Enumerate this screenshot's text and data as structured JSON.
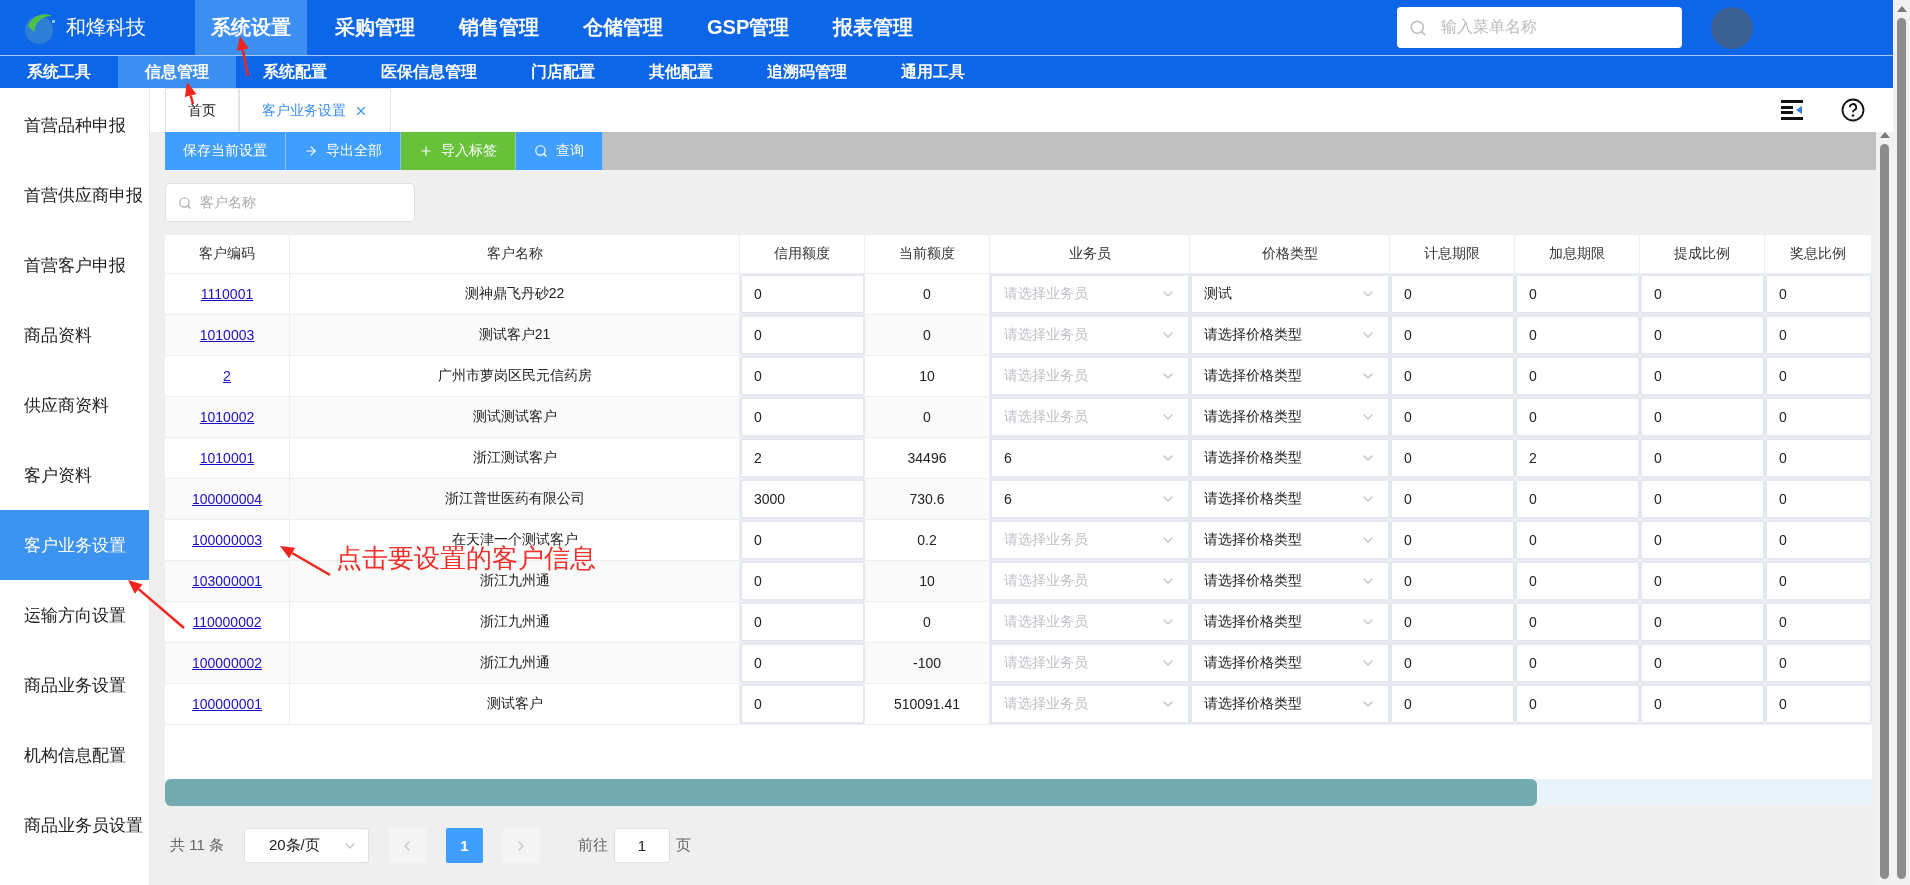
{
  "brand": {
    "name": "和烽科技"
  },
  "top_nav": [
    {
      "label": "系统设置",
      "selected": true
    },
    {
      "label": "采购管理",
      "selected": false
    },
    {
      "label": "销售管理",
      "selected": false
    },
    {
      "label": "仓储管理",
      "selected": false
    },
    {
      "label": "GSP管理",
      "selected": false
    },
    {
      "label": "报表管理",
      "selected": false
    }
  ],
  "menu_search": {
    "placeholder": "输入菜单名称"
  },
  "sub_nav": [
    {
      "label": "系统工具",
      "selected": false
    },
    {
      "label": "信息管理",
      "selected": true
    },
    {
      "label": "系统配置",
      "selected": false
    },
    {
      "label": "医保信息管理",
      "selected": false
    },
    {
      "label": "门店配置",
      "selected": false
    },
    {
      "label": "其他配置",
      "selected": false
    },
    {
      "label": "追溯码管理",
      "selected": false
    },
    {
      "label": "通用工具",
      "selected": false
    }
  ],
  "sidebar": {
    "items": [
      {
        "label": "首营品种申报",
        "selected": false
      },
      {
        "label": "首营供应商申报",
        "selected": false
      },
      {
        "label": "首营客户申报",
        "selected": false
      },
      {
        "label": "商品资料",
        "selected": false
      },
      {
        "label": "供应商资料",
        "selected": false
      },
      {
        "label": "客户资料",
        "selected": false
      },
      {
        "label": "客户业务设置",
        "selected": true
      },
      {
        "label": "运输方向设置",
        "selected": false
      },
      {
        "label": "商品业务设置",
        "selected": false
      },
      {
        "label": "机构信息配置",
        "selected": false
      },
      {
        "label": "商品业务员设置",
        "selected": false
      }
    ]
  },
  "page_tabs": [
    {
      "label": "首页",
      "selected": false,
      "closable": false
    },
    {
      "label": "客户业务设置",
      "selected": true,
      "closable": true
    }
  ],
  "toolbar": [
    {
      "label": "保存当前设置",
      "kind": "primary"
    },
    {
      "label": "导出全部",
      "kind": "primary"
    },
    {
      "label": "导入标签",
      "kind": "success"
    },
    {
      "label": "查询",
      "kind": "primary"
    }
  ],
  "filter": {
    "placeholder": "客户名称"
  },
  "table": {
    "columns": [
      "客户编码",
      "客户名称",
      "信用额度",
      "当前额度",
      "业务员",
      "价格类型",
      "计息期限",
      "加息期限",
      "提成比例",
      "奖息比例"
    ],
    "rows": [
      {
        "code": "1110001",
        "name": "测神鼎飞丹砂22",
        "credit": "0",
        "current": "0",
        "salesman": {
          "placeholder": "请选择业务员"
        },
        "price_type": "测试",
        "interest_term": "0",
        "add_term": "0",
        "commission": "0",
        "bonus": "0"
      },
      {
        "code": "1010003",
        "name": "测试客户21",
        "credit": "0",
        "current": "0",
        "salesman": {
          "placeholder": "请选择业务员"
        },
        "price_type": "请选择价格类型",
        "interest_term": "0",
        "add_term": "0",
        "commission": "0",
        "bonus": "0"
      },
      {
        "code": "2",
        "name": "广州市萝岗区民元信药房",
        "credit": "0",
        "current": "10",
        "salesman": {
          "placeholder": "请选择业务员"
        },
        "price_type": "请选择价格类型",
        "interest_term": "0",
        "add_term": "0",
        "commission": "0",
        "bonus": "0"
      },
      {
        "code": "1010002",
        "name": "测试测试客户",
        "credit": "0",
        "current": "0",
        "salesman": {
          "placeholder": "请选择业务员"
        },
        "price_type": "请选择价格类型",
        "interest_term": "0",
        "add_term": "0",
        "commission": "0",
        "bonus": "0"
      },
      {
        "code": "1010001",
        "name": "浙江测试客户",
        "credit": "2",
        "current": "34496",
        "salesman": {
          "value": "6"
        },
        "price_type": "请选择价格类型",
        "interest_term": "0",
        "add_term": "2",
        "commission": "0",
        "bonus": "0"
      },
      {
        "code": "100000004",
        "name": "浙江普世医药有限公司",
        "credit": "3000",
        "current": "730.6",
        "salesman": {
          "value": "6"
        },
        "price_type": "请选择价格类型",
        "interest_term": "0",
        "add_term": "0",
        "commission": "0",
        "bonus": "0"
      },
      {
        "code": "100000003",
        "name": "在天津一个测试客户",
        "credit": "0",
        "current": "0.2",
        "salesman": {
          "placeholder": "请选择业务员"
        },
        "price_type": "请选择价格类型",
        "interest_term": "0",
        "add_term": "0",
        "commission": "0",
        "bonus": "0"
      },
      {
        "code": "103000001",
        "name": "浙江九州通",
        "credit": "0",
        "current": "10",
        "salesman": {
          "placeholder": "请选择业务员"
        },
        "price_type": "请选择价格类型",
        "interest_term": "0",
        "add_term": "0",
        "commission": "0",
        "bonus": "0"
      },
      {
        "code": "110000002",
        "name": "浙江九州通",
        "credit": "0",
        "current": "0",
        "salesman": {
          "placeholder": "请选择业务员"
        },
        "price_type": "请选择价格类型",
        "interest_term": "0",
        "add_term": "0",
        "commission": "0",
        "bonus": "0"
      },
      {
        "code": "100000002",
        "name": "浙江九州通",
        "credit": "0",
        "current": "-100",
        "salesman": {
          "placeholder": "请选择业务员"
        },
        "price_type": "请选择价格类型",
        "interest_term": "0",
        "add_term": "0",
        "commission": "0",
        "bonus": "0"
      },
      {
        "code": "100000001",
        "name": "测试客户",
        "credit": "0",
        "current": "510091.41",
        "salesman": {
          "placeholder": "请选择业务员"
        },
        "price_type": "请选择价格类型",
        "interest_term": "0",
        "add_term": "0",
        "commission": "0",
        "bonus": "0"
      }
    ]
  },
  "pagination": {
    "total": "共 11 条",
    "page_size": "20条/页",
    "pages": [
      {
        "label": "1",
        "selected": true
      }
    ],
    "goto_label": "前往",
    "goto_value": "1",
    "page_suffix": "页"
  },
  "annotation": {
    "text": "点击要设置的客户信息"
  }
}
